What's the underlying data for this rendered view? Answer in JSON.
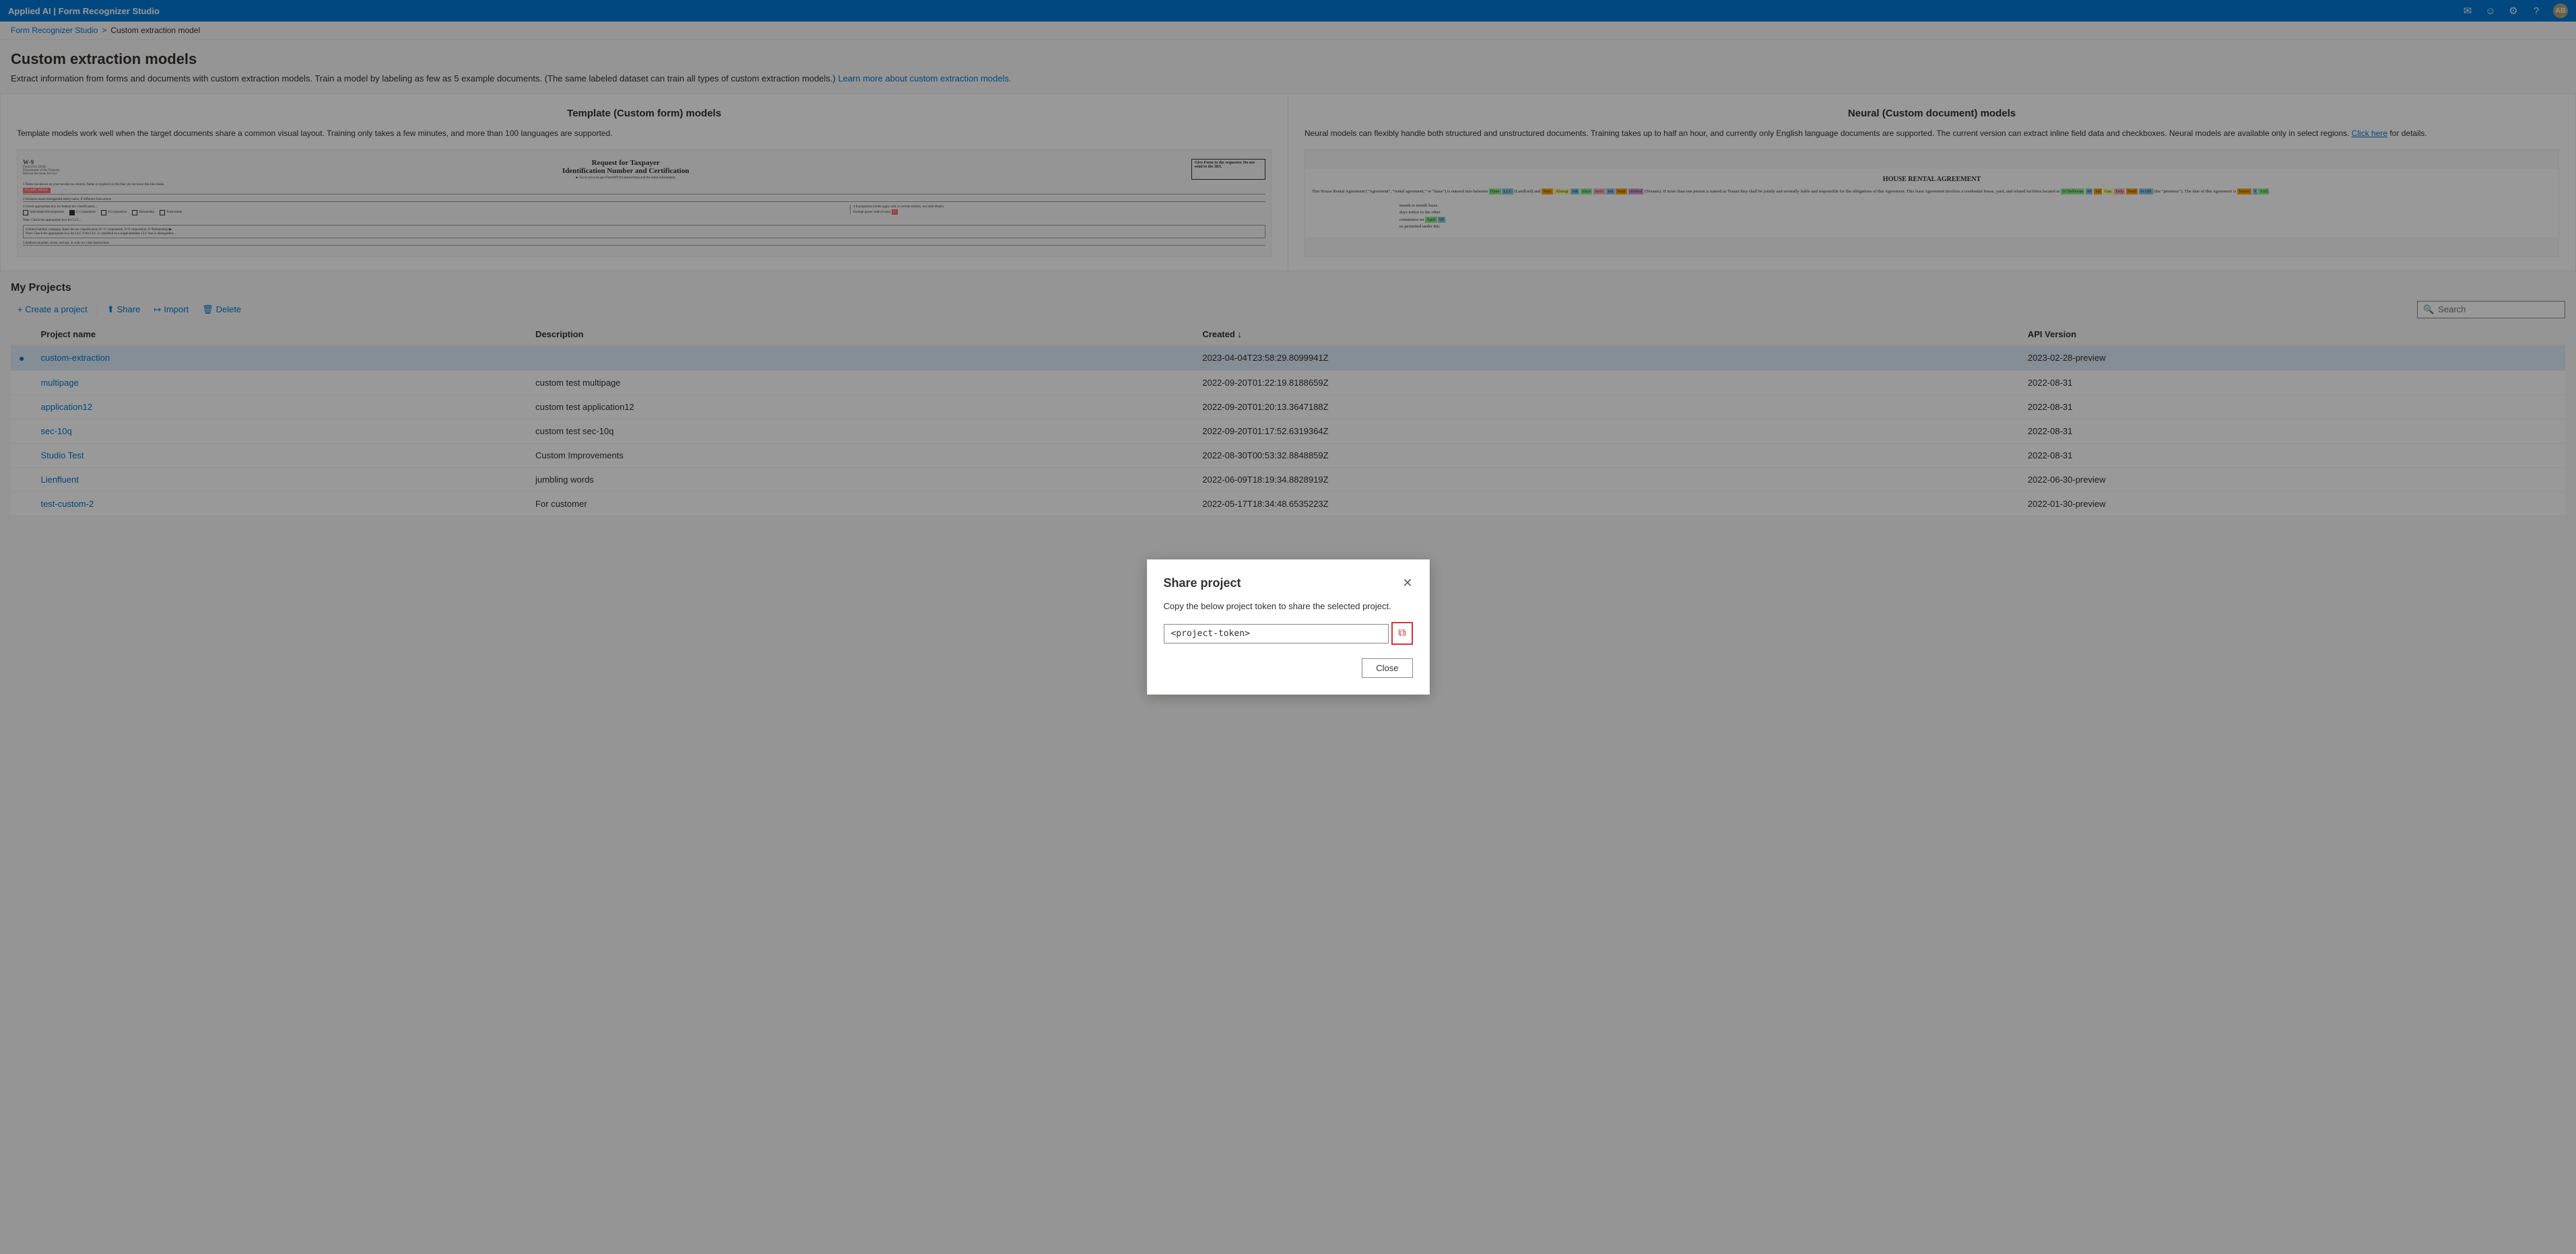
{
  "app": {
    "title": "Applied AI | Form Recognizer Studio"
  },
  "topbar": {
    "title": "Applied AI | Form Recognizer Studio",
    "icons": [
      "email-icon",
      "smiley-icon",
      "settings-icon",
      "help-icon",
      "user-icon"
    ]
  },
  "breadcrumb": {
    "root": "Form Recognizer Studio",
    "separator": ">",
    "current": "Custom extraction model"
  },
  "page": {
    "title": "Custom extraction models",
    "description": "Extract information from forms and documents with custom extraction models. Train a model by labeling as few as 5 example documents. (The same labeled dataset can train all types of custom extraction models.)",
    "learn_more_text": "Learn more about custom extraction models.",
    "learn_more_href": "#"
  },
  "template_col": {
    "title": "Template (Custom form) models",
    "description": "Template models work well when the target documents share a common visual layout. Training only takes a few minutes, and more than 100 languages are supported."
  },
  "neural_col": {
    "title": "Neural (Custom document) models",
    "description": "Neural models can flexibly handle both structured and unstructured documents. Training takes up to half an hour, and currently only English language documents are supported. The current version can extract inline field data and checkboxes. Neural models are available only in select regions.",
    "click_here": "Click here",
    "details_suffix": " for details."
  },
  "projects": {
    "title": "My Projects",
    "toolbar": {
      "create": "+ Create a project",
      "share": "Share",
      "import": "Import",
      "delete": "Delete"
    },
    "search_placeholder": "Search",
    "columns": {
      "name": "Project name",
      "description": "Description",
      "created": "Created ↓",
      "api_version": "API Version"
    },
    "rows": [
      {
        "name": "custom-extraction",
        "description": "",
        "created": "2023-04-04T23:58:29.8099941Z",
        "api_version": "2023-02-28-preview",
        "selected": true
      },
      {
        "name": "multipage",
        "description": "custom test multipage",
        "created": "2022-09-20T01:22:19.8188659Z",
        "api_version": "2022-08-31",
        "selected": false
      },
      {
        "name": "application12",
        "description": "custom test application12",
        "created": "2022-09-20T01:20:13.3647188Z",
        "api_version": "2022-08-31",
        "selected": false
      },
      {
        "name": "sec-10q",
        "description": "custom test sec-10q",
        "created": "2022-09-20T01:17:52.6319364Z",
        "api_version": "2022-08-31",
        "selected": false
      },
      {
        "name": "Studio Test",
        "description": "Custom Improvements",
        "created": "2022-08-30T00:53:32.8848859Z",
        "api_version": "2022-08-31",
        "selected": false
      },
      {
        "name": "Lienfluent",
        "description": "jumbling words",
        "created": "2022-06-09T18:19:34.8828919Z",
        "api_version": "2022-06-30-preview",
        "selected": false
      },
      {
        "name": "test-custom-2",
        "description": "For customer",
        "created": "2022-05-17T18:34:48.6535223Z",
        "api_version": "2022-01-30-preview",
        "selected": false
      }
    ]
  },
  "modal": {
    "title": "Share project",
    "description": "Copy the below project token to share the selected project.",
    "token_placeholder": "<project-token>",
    "token_value": "<project-token>",
    "close_label": "Close"
  }
}
